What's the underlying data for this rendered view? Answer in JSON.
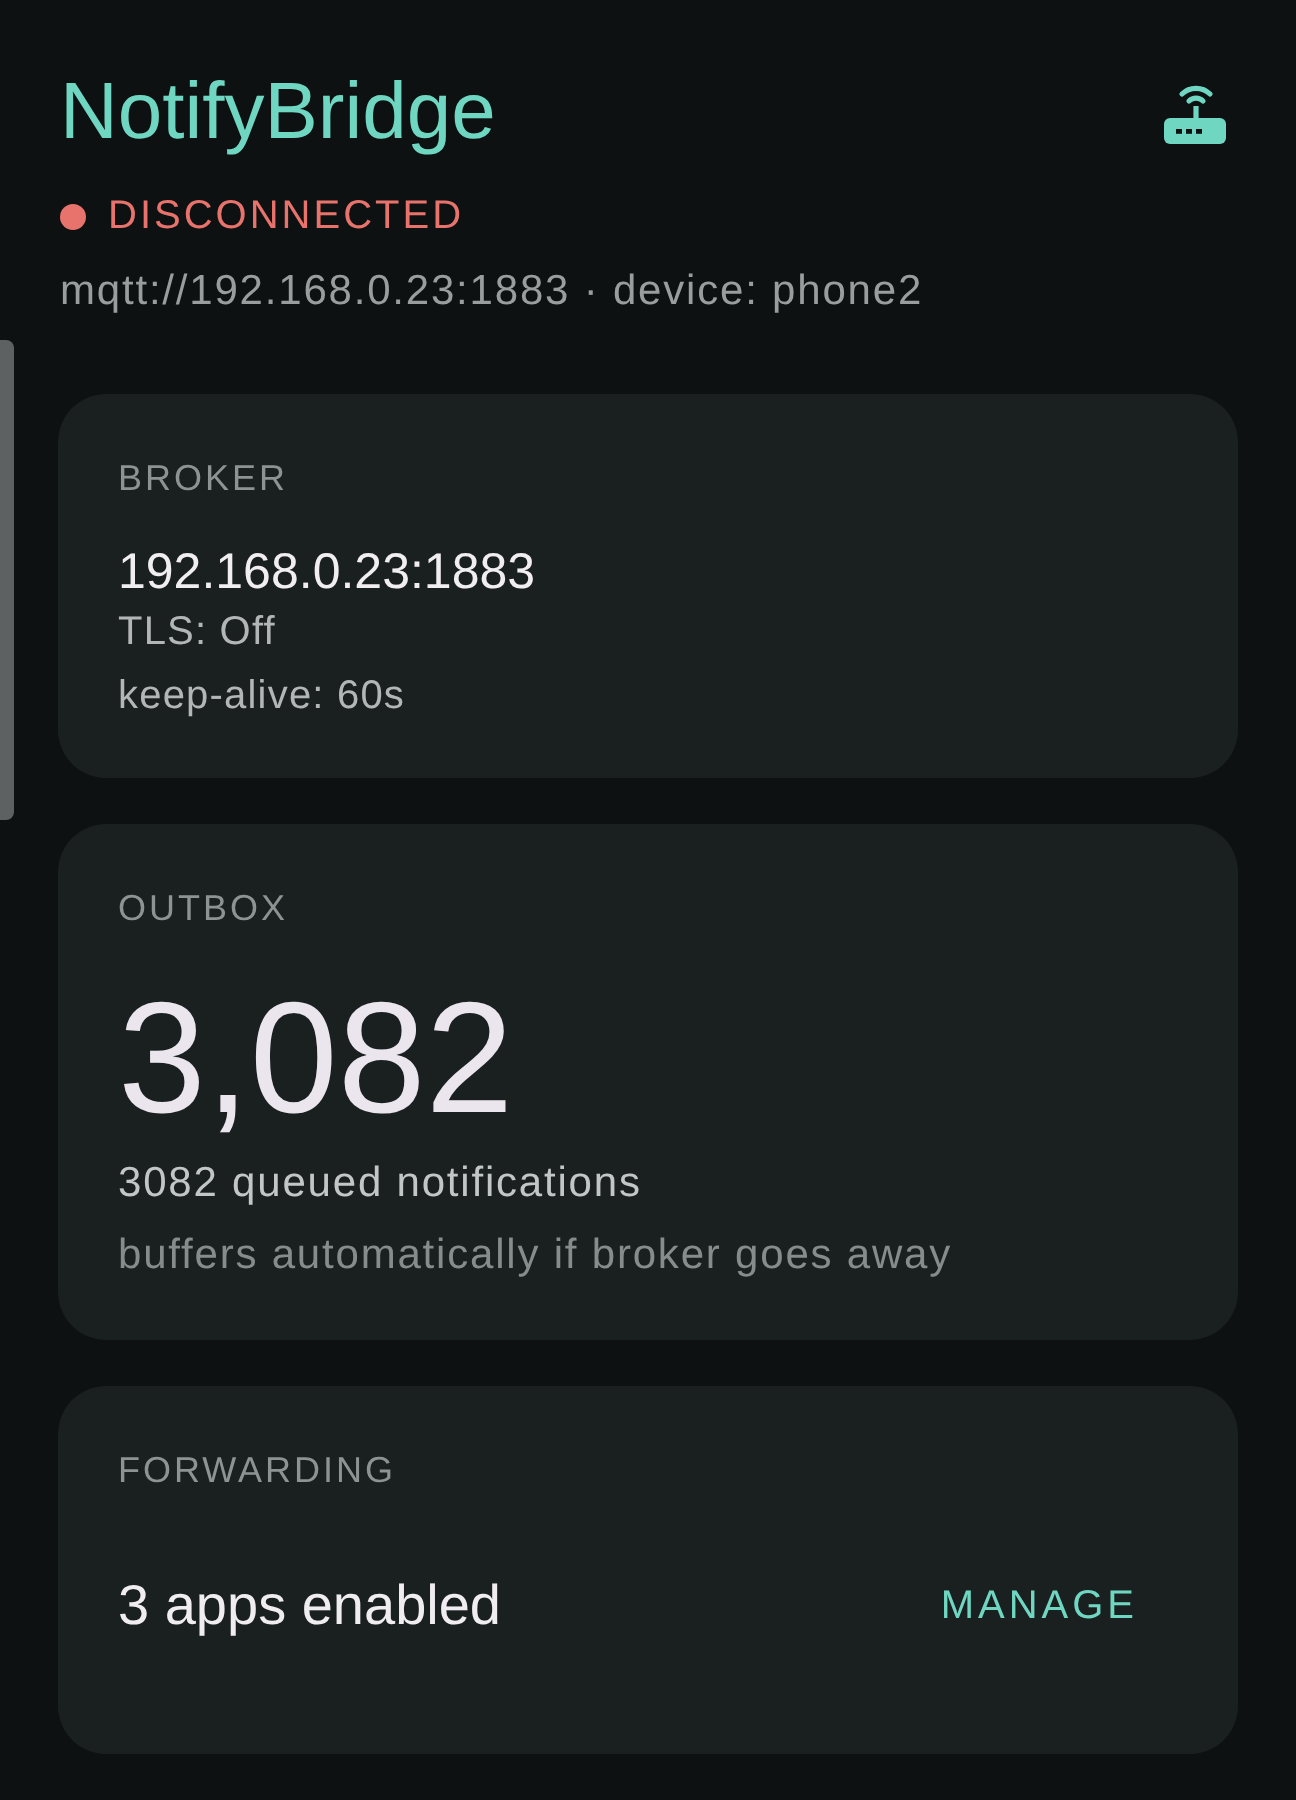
{
  "app": {
    "title": "NotifyBridge"
  },
  "status": {
    "connected": false,
    "label": "DISCONNECTED",
    "endpoint": "mqtt://192.168.0.23:1883 · device: phone2"
  },
  "cards": [
    {
      "kind": "broker",
      "label": "BROKER",
      "address": "192.168.0.23:1883",
      "lines": [
        "TLS: Off",
        "keep-alive: 60s"
      ]
    },
    {
      "kind": "outbox",
      "label": "OUTBOX",
      "count": "3,082",
      "caption": "3082 queued notifications",
      "note": "buffers automatically if broker goes away"
    },
    {
      "kind": "forwarding",
      "label": "FORWARDING",
      "summary": "3 apps enabled",
      "action": "MANAGE"
    }
  ]
}
